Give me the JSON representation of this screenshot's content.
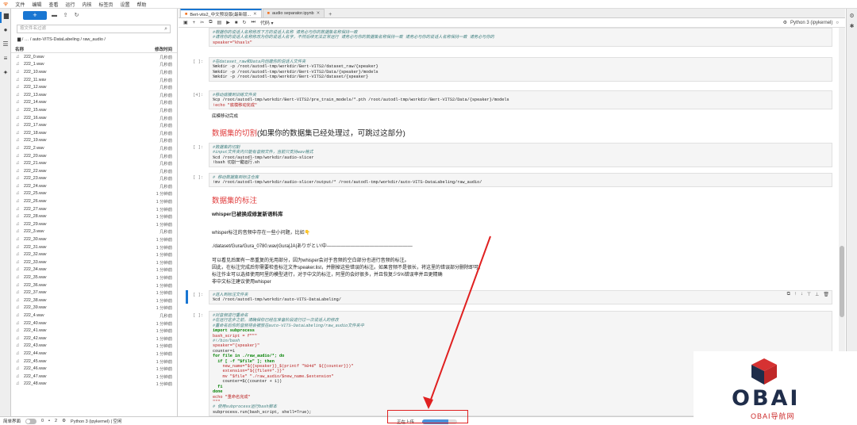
{
  "menubar": {
    "logo": "ᯤ",
    "items": [
      "文件",
      "编辑",
      "查看",
      "运行",
      "内核",
      "标签页",
      "设置",
      "帮助"
    ]
  },
  "filebrowser": {
    "new_label": "+",
    "filter_placeholder": "按文件名过滤",
    "breadcrumb": "/ … / auto-VITS-DataLabeling / raw_audio /",
    "col_name": "名称",
    "col_modified": "修改时间",
    "files": [
      {
        "name": "222_0.wav",
        "date": "几秒前"
      },
      {
        "name": "222_1.wav",
        "date": "几秒前"
      },
      {
        "name": "222_10.wav",
        "date": "几秒前"
      },
      {
        "name": "222_11.wav",
        "date": "几秒前"
      },
      {
        "name": "222_12.wav",
        "date": "几秒前"
      },
      {
        "name": "222_13.wav",
        "date": "几秒前"
      },
      {
        "name": "222_14.wav",
        "date": "几秒前"
      },
      {
        "name": "222_15.wav",
        "date": "几秒前"
      },
      {
        "name": "222_16.wav",
        "date": "几秒前"
      },
      {
        "name": "222_17.wav",
        "date": "几秒前"
      },
      {
        "name": "222_18.wav",
        "date": "几秒前"
      },
      {
        "name": "222_19.wav",
        "date": "几秒前"
      },
      {
        "name": "222_2.wav",
        "date": "几秒前"
      },
      {
        "name": "222_20.wav",
        "date": "几秒前"
      },
      {
        "name": "222_21.wav",
        "date": "几秒前"
      },
      {
        "name": "222_22.wav",
        "date": "几秒前"
      },
      {
        "name": "222_23.wav",
        "date": "几秒前"
      },
      {
        "name": "222_24.wav",
        "date": "几秒前"
      },
      {
        "name": "222_25.wav",
        "date": "1 分钟前"
      },
      {
        "name": "222_26.wav",
        "date": "1 分钟前"
      },
      {
        "name": "222_27.wav",
        "date": "1 分钟前"
      },
      {
        "name": "222_28.wav",
        "date": "1 分钟前"
      },
      {
        "name": "222_29.wav",
        "date": "1 分钟前"
      },
      {
        "name": "222_3.wav",
        "date": "几秒前"
      },
      {
        "name": "222_30.wav",
        "date": "1 分钟前"
      },
      {
        "name": "222_31.wav",
        "date": "1 分钟前"
      },
      {
        "name": "222_32.wav",
        "date": "1 分钟前"
      },
      {
        "name": "222_33.wav",
        "date": "1 分钟前"
      },
      {
        "name": "222_34.wav",
        "date": "1 分钟前"
      },
      {
        "name": "222_35.wav",
        "date": "1 分钟前"
      },
      {
        "name": "222_36.wav",
        "date": "1 分钟前"
      },
      {
        "name": "222_37.wav",
        "date": "1 分钟前"
      },
      {
        "name": "222_38.wav",
        "date": "1 分钟前"
      },
      {
        "name": "222_39.wav",
        "date": "1 分钟前"
      },
      {
        "name": "222_4.wav",
        "date": "几秒前"
      },
      {
        "name": "222_40.wav",
        "date": "1 分钟前"
      },
      {
        "name": "222_41.wav",
        "date": "1 分钟前"
      },
      {
        "name": "222_42.wav",
        "date": "1 分钟前"
      },
      {
        "name": "222_43.wav",
        "date": "1 分钟前"
      },
      {
        "name": "222_44.wav",
        "date": "1 分钟前"
      },
      {
        "name": "222_45.wav",
        "date": "1 分钟前"
      },
      {
        "name": "222_46.wav",
        "date": "1 分钟前"
      },
      {
        "name": "222_47.wav",
        "date": "1 分钟前"
      },
      {
        "name": "222_48.wav",
        "date": "1 分钟前"
      }
    ]
  },
  "tabs": [
    {
      "label": "Bert-vits2_中文预设版(最新版...",
      "active": true
    },
    {
      "label": "audio separator.ipynb",
      "active": false
    }
  ],
  "nbtoolbar": {
    "celltype": "代码",
    "kernel": "Python 3 (ipykernel)"
  },
  "cells": [
    {
      "prompt": "",
      "lines": [
        "#根据你的说话人名称修改下方的说话人名称 请务必与你的数据集名称保持一致",
        "#请将你的说话人名称修改为你的说话人名字，不然后续无法正常运行 请务必与你的数据集名称保持一致 请务必与你的说话人名称保持一致 请务必与你的",
        "speaker=\"khaslx\""
      ]
    },
    {
      "prompt": "[ ]:",
      "lines": [
        "#在dataset_raw和Data内创建你的说话人文件夹",
        "%mkdir -p /root/autodl-tmp/workdir/Bert-VITS2/dataset_raw/{speaker}",
        "%mkdir -p /root/autodl-tmp/workdir/Bert-VITS2/Data/{speaker}/models",
        "%mkdir -p /root/autodl-tmp/workdir/Bert-VITS2/dataset/{speaker}"
      ]
    },
    {
      "prompt": "[4]:",
      "lines": [
        "#移动底模到训练文件夹",
        "%cp /root/autodl-tmp/workdir/Bert-VITS2/pre_train_models/*.pth /root/autodl-tmp/workdir/Bert-VITS2/Data/{speaker}/models",
        "!echo \"底模移动完成\""
      ],
      "output": "底模移动完成"
    },
    {
      "prompt": "[ ]:",
      "lines": [
        "#数据集的切割",
        "#input文件夹内只能有音频文件，当前只支持wav格式",
        "%cd /root/autodl-tmp/workdir/audio-slicer",
        "!bash 切割一键运行.sh"
      ]
    },
    {
      "prompt": "[ ]:",
      "lines": [
        "# 移动数据集到标注仓库",
        "!mv /root/autodl-tmp/workdir/audio-slicer/output/* /root/autodl-tmp/workdir/auto-VITS-DataLabeling/raw_audio/"
      ]
    },
    {
      "prompt": "[ ]:",
      "lines": [
        "#进入到标注文件夹",
        "%cd /root/autodl-tmp/workdir/auto-VITS-DataLabeling/"
      ]
    },
    {
      "prompt": "[ ]:",
      "lines": [
        "#对音频进行重命名",
        "#在运行这步之前，请确保你已经在准备阶段进行过一次说话人的修改",
        "#重命名后你的音频将会被放在auto-VITS-DataLabeling/raw_audio文件夹中",
        "import subprocess",
        "bash_script = f\"\"\"",
        "#!/bin/bash",
        "speaker=\"{speaker}\"",
        "counter=1",
        "for file in ./raw_audio/*; do",
        "  if [ -f \"$file\" ]; then",
        "    new_name=\"${{speaker}}_$(printf \"%04d\" ${{counter}})\"",
        "    extension=\"${{file##*.}}\"",
        "    mv \"$file\" \"./raw_audio/$new_name.$extension\"",
        "    counter=$((counter + 1))",
        "  fi",
        "done",
        "echo \"重命名完成\"",
        "\"\"\"",
        "# 使用subprocess运行bash脚本",
        "subprocess.run(bash_script, shell=True);"
      ]
    }
  ],
  "markdown": {
    "slice_title_red": "数据集的切割",
    "slice_title_rest": "(如果你的数据集已经处理过，可跳过这部分)",
    "label_title": "数据集的标注",
    "whisper_heading": "whisper已被换成修复新语料库",
    "para1": "whisper标注的音频中存在一些小问题，比如👇",
    "para2": "./dataset/Gura/Gura_0780.wav|Gura|JA|ありがとい!中——————————————————",
    "para3": "可以看见后面有一串重复的无用部分，因为whisper会对于音频的空白部分也进行音频的标注。",
    "para4": "因此，在标注完成后你需要检查标注文件speaker.list，并删掉这些错误的标注。如果音频不是很长，将这里的错误部分删除即可。",
    "para5": "标注作业可以选择使用阿里的模型进行，对于中文的标注，阿里的会好很多，并且恢复少5%错误率并且更精确",
    "para6": "非中文标注建议使用whisper"
  },
  "statusbar": {
    "mode": "简单界面",
    "count1": "0",
    "count2": "2",
    "kernel": "Python 3 (ipykernel) | 空闲",
    "uploading": "正在上传...",
    "upload_progress": 0.75
  },
  "watermark": {
    "title": "OBAI",
    "subtitle": "OBAI导航网"
  }
}
